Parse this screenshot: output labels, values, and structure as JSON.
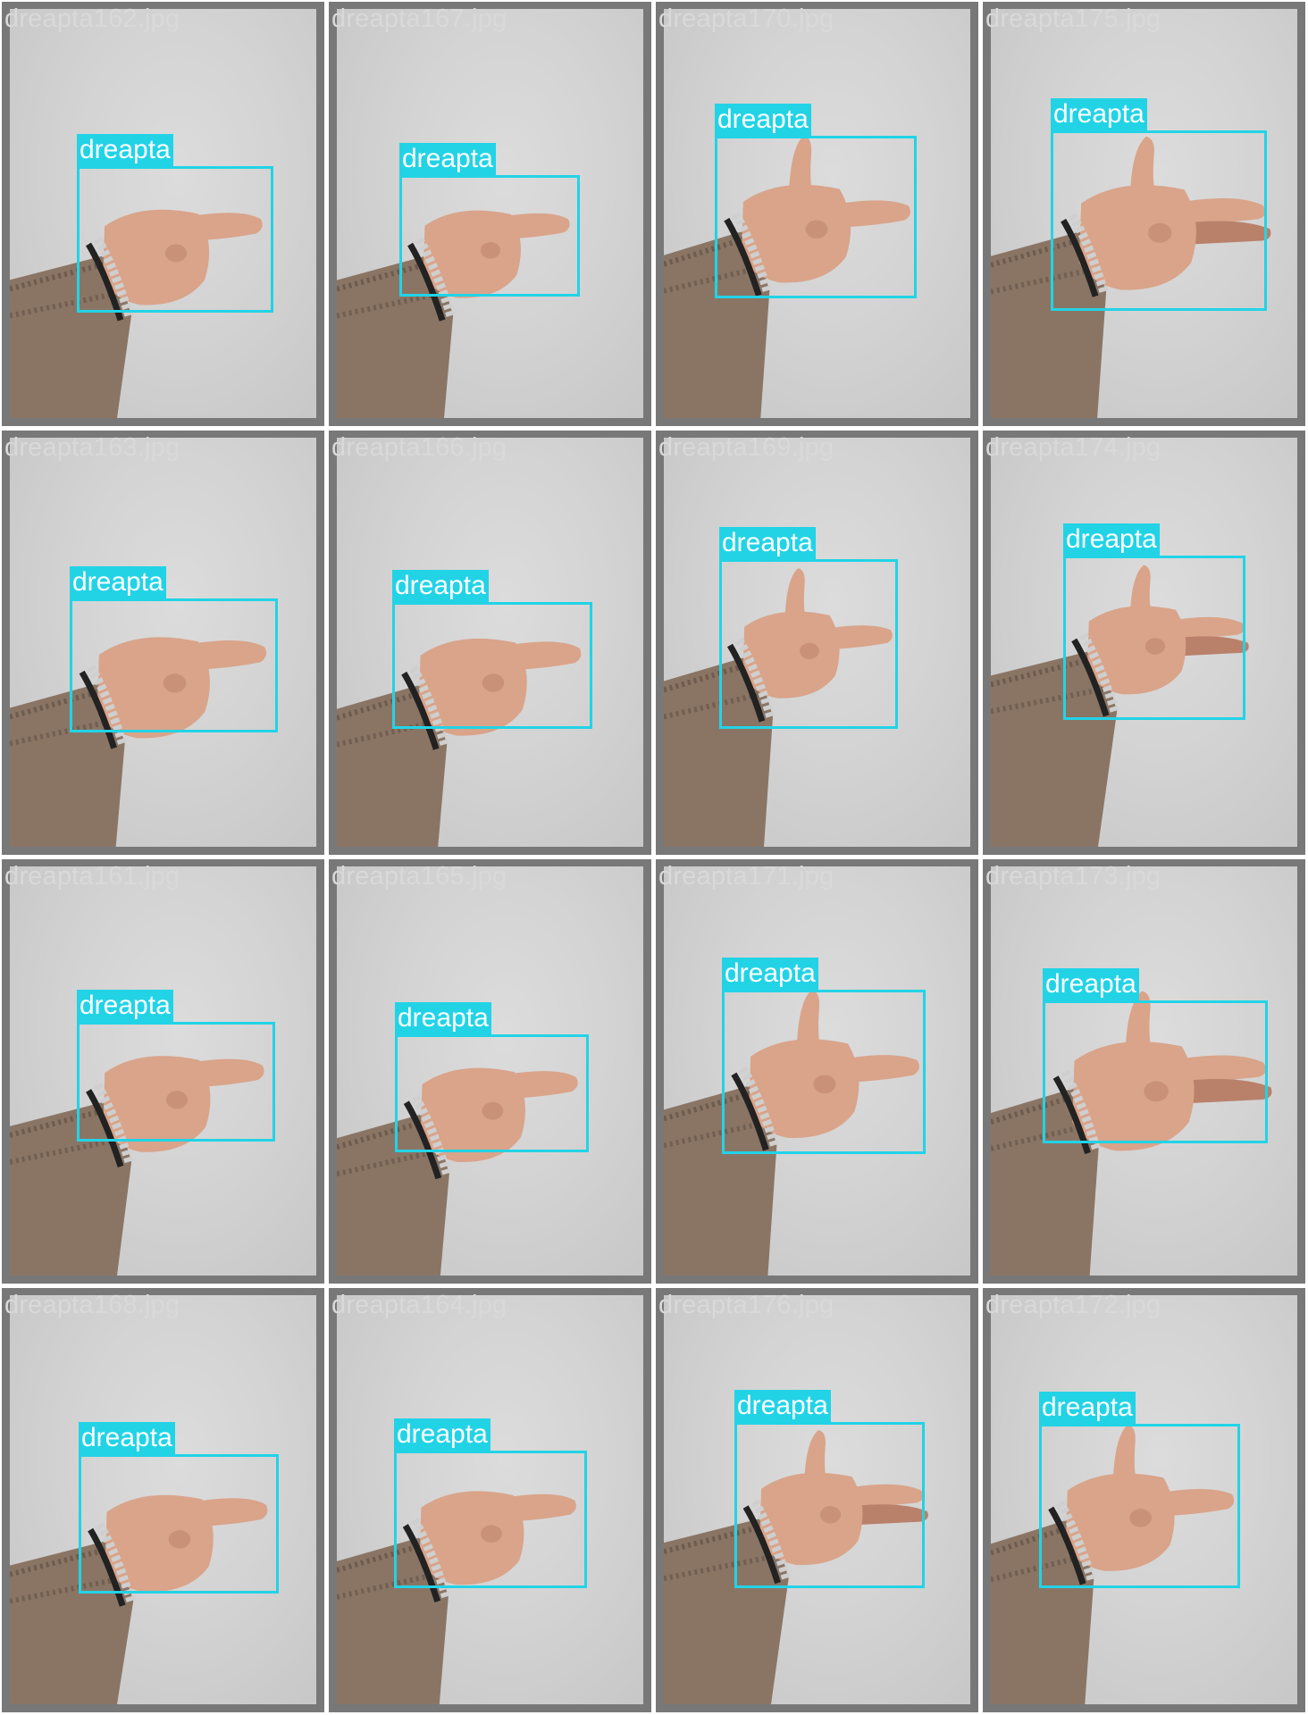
{
  "colors": {
    "box": "#22d3e6",
    "frame": "#787878",
    "background": "#d3d3d3",
    "filename_text": "#d9d9d9"
  },
  "tiles": [
    {
      "filename": "dreapta162.jpg",
      "label": "dreapta",
      "pose": "point"
    },
    {
      "filename": "dreapta167.jpg",
      "label": "dreapta",
      "pose": "point"
    },
    {
      "filename": "dreapta170.jpg",
      "label": "dreapta",
      "pose": "gun"
    },
    {
      "filename": "dreapta175.jpg",
      "label": "dreapta",
      "pose": "gun2"
    },
    {
      "filename": "dreapta163.jpg",
      "label": "dreapta",
      "pose": "point"
    },
    {
      "filename": "dreapta166.jpg",
      "label": "dreapta",
      "pose": "point"
    },
    {
      "filename": "dreapta169.jpg",
      "label": "dreapta",
      "pose": "gun"
    },
    {
      "filename": "dreapta174.jpg",
      "label": "dreapta",
      "pose": "gun2"
    },
    {
      "filename": "dreapta161.jpg",
      "label": "dreapta",
      "pose": "point"
    },
    {
      "filename": "dreapta165.jpg",
      "label": "dreapta",
      "pose": "point"
    },
    {
      "filename": "dreapta171.jpg",
      "label": "dreapta",
      "pose": "gun"
    },
    {
      "filename": "dreapta173.jpg",
      "label": "dreapta",
      "pose": "gun2"
    },
    {
      "filename": "dreapta168.jpg",
      "label": "dreapta",
      "pose": "point"
    },
    {
      "filename": "dreapta164.jpg",
      "label": "dreapta",
      "pose": "point"
    },
    {
      "filename": "dreapta176.jpg",
      "label": "dreapta",
      "pose": "gun2"
    },
    {
      "filename": "dreapta172.jpg",
      "label": "dreapta",
      "pose": "gun"
    }
  ]
}
